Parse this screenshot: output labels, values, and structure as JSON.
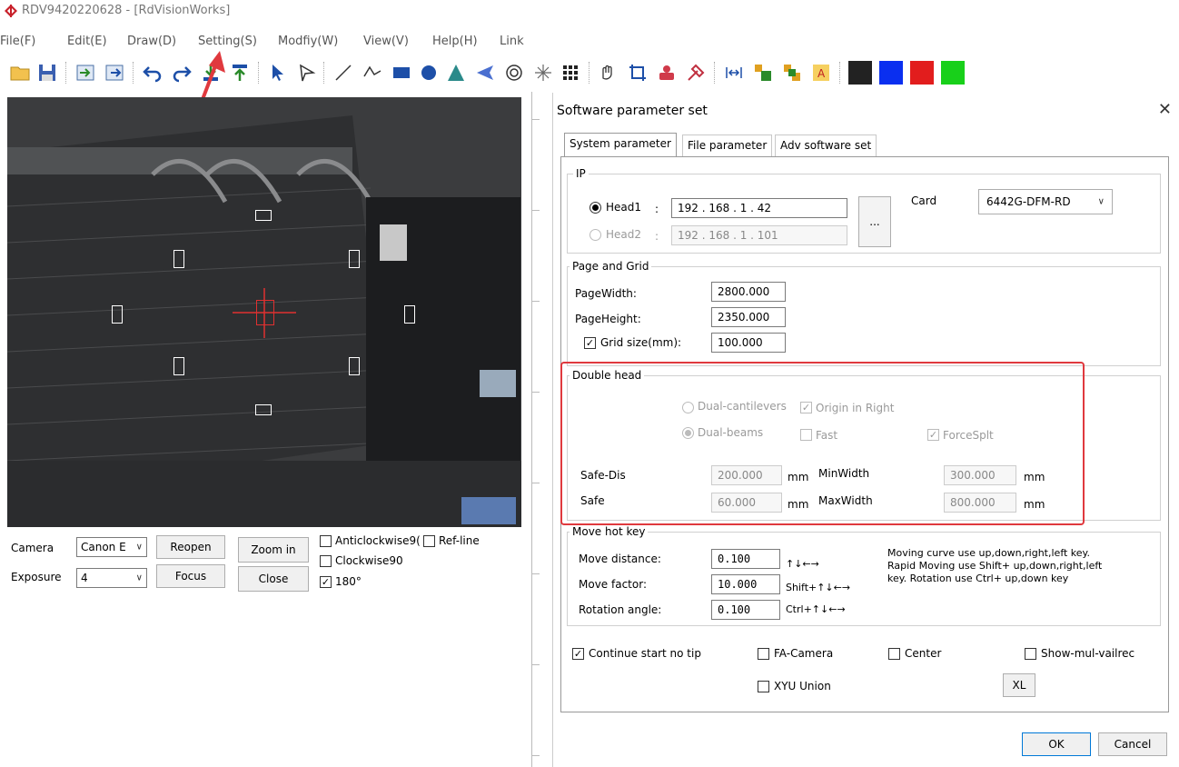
{
  "window": {
    "title": "RDV9420220628 - [RdVisionWorks]"
  },
  "menu": [
    "File(F)",
    "Edit(E)",
    "Draw(D)",
    "Setting(S)",
    "Modfiy(W)",
    "View(V)",
    "Help(H)",
    "Link"
  ],
  "camera_panel": {
    "camera_label": "Camera",
    "camera_value": "Canon E",
    "exposure_label": "Exposure",
    "exposure_value": "4",
    "reopen": "Reopen",
    "zoom_in": "Zoom in",
    "focus": "Focus",
    "close": "Close",
    "anticlockwise": "Anticlockwise9(",
    "ref_line": "Ref-line",
    "clockwise": "Clockwise90",
    "rot180": "180°",
    "rot180_checked": true
  },
  "dialog": {
    "title": "Software parameter set",
    "tabs": [
      "System parameter",
      "File parameter",
      "Adv software set"
    ],
    "ip": {
      "group": "IP",
      "head1_label": "Head1",
      "head2_label": "Head2",
      "colon": ":",
      "head1_ip": "192 . 168 .  1  .  42",
      "head2_ip": "192 . 168 .  1  . 101",
      "browse": "...",
      "card_label": "Card",
      "card_value": "6442G-DFM-RD"
    },
    "page_grid": {
      "group": "Page and Grid",
      "page_width_label": "PageWidth:",
      "page_width": "2800.000",
      "page_height_label": "PageHeight:",
      "page_height": "2350.000",
      "grid_label": "Grid size(mm):",
      "grid": "100.000"
    },
    "double_head": {
      "group": "Double head",
      "dual_cantilevers": "Dual-cantilevers",
      "origin_in_right": "Origin in Right",
      "dual_beams": "Dual-beams",
      "fast": "Fast",
      "force_split": "ForceSplt",
      "safe_dis_label": "Safe-Dis",
      "safe_dis": "200.000",
      "safe_label": "Safe",
      "safe": "60.000",
      "mm": "mm",
      "min_width_label": "MinWidth",
      "min_width": "300.000",
      "max_width_label": "MaxWidth",
      "max_width": "800.000"
    },
    "move_hot_key": {
      "group": "Move hot key",
      "distance_label": "Move distance:",
      "distance": "0.100",
      "distance_keys": "↑↓←→",
      "factor_label": "Move factor:",
      "factor": "10.000",
      "factor_keys": "Shift+↑↓←→",
      "rotation_label": "Rotation angle:",
      "rotation": "0.100",
      "rotation_keys": "Ctrl+↑↓←→",
      "help_line1": "Moving curve use up,down,right,left key.",
      "help_line2": "Rapid Moving use Shift+ up,down,right,left",
      "help_line3": "key. Rotation use Ctrl+ up,down key"
    },
    "options": {
      "continue_start": "Continue start no tip",
      "fa_camera": "FA-Camera",
      "center": "Center",
      "show_mul": "Show-mul-vailrec",
      "xyu_union": "XYU Union",
      "xl": "XL"
    },
    "ok": "OK",
    "cancel": "Cancel"
  },
  "colors": {
    "annotation_red": "#e0393e",
    "palette": [
      "#222222",
      "#0a2ff0",
      "#e21d1d",
      "#18d01a"
    ]
  }
}
